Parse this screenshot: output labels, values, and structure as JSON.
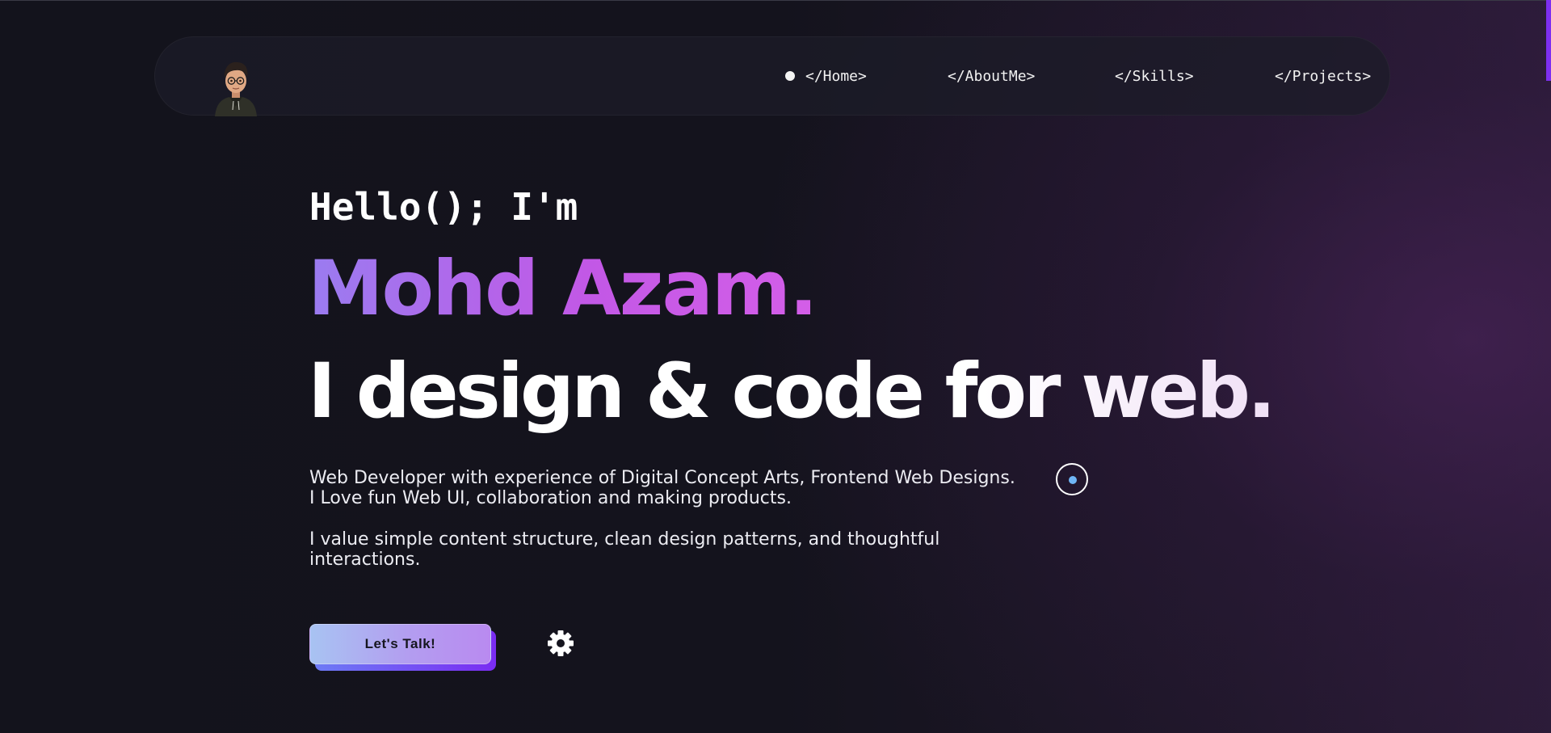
{
  "nav": {
    "items": [
      {
        "label": "</Home>",
        "active": true
      },
      {
        "label": "</AboutMe>",
        "active": false
      },
      {
        "label": "</Skills>",
        "active": false
      },
      {
        "label": "</Projects>",
        "active": false
      }
    ]
  },
  "hero": {
    "greeting": "Hello(); I'm",
    "name": "Mohd Azam.",
    "tagline": "I design & code for web.",
    "paragraph1": "Web Developer with experience of Digital Concept Arts, Frontend Web Designs. I Love fun Web UI, collaboration and making products.",
    "paragraph2": "I value simple content structure, clean design patterns, and thoughtful interactions.",
    "cta_label": "Let's Talk!"
  },
  "icons": {
    "avatar": "avatar",
    "settings": "gear-icon",
    "cursor": "cursor-ring"
  },
  "colors": {
    "background": "#14131d",
    "accent_purple": "#c258e6",
    "accent_blue": "#9a7cf0",
    "cursor_dot": "#6fb6f5",
    "scroll_thumb": "#7d2ff0"
  }
}
